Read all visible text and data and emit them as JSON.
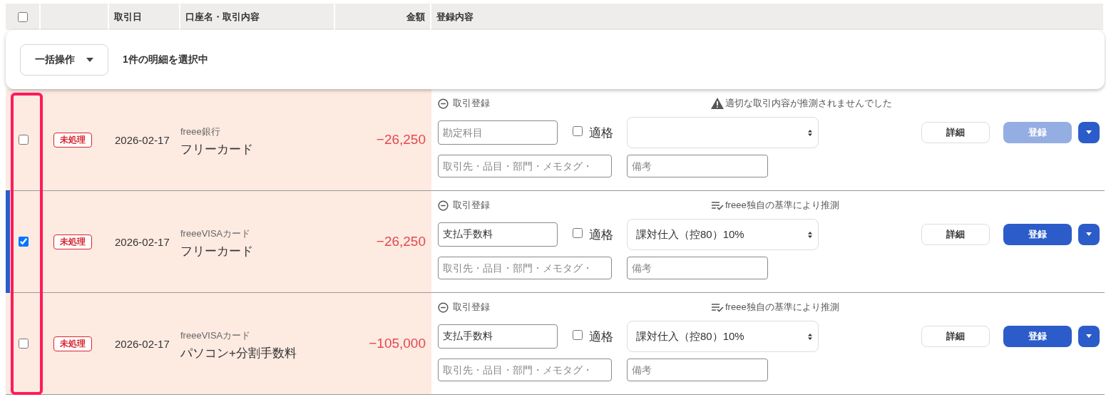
{
  "header": {
    "select_all": {
      "checked": false
    },
    "columns": [
      "取引日",
      "口座名・取引内容",
      "金額",
      "登録内容"
    ]
  },
  "bulk_bar": {
    "action": "一括操作",
    "status": "1件の明細を選択中"
  },
  "rows": [
    {
      "selected": false,
      "status": "未処理",
      "date": "2026-02-17",
      "account": "freee銀行",
      "description": "フリーカード",
      "amount": "−26,250",
      "register": {
        "toggle": "取引登録",
        "note": {
          "kind": "warning",
          "text": "適切な取引内容が推測されませんでした"
        },
        "account_field": {
          "placeholder": "勘定科目"
        },
        "qualified": {
          "label": "適格",
          "checked": false
        },
        "partner_field": {
          "placeholder": "取引先・品目・部門・メモタグ・"
        },
        "memo_field": {
          "placeholder": "備考"
        },
        "detail_button": "詳細",
        "register_button": {
          "label": "登録",
          "disabled": true
        }
      }
    },
    {
      "selected": true,
      "status": "未処理",
      "date": "2026-02-17",
      "account": "freeeVISAカード",
      "description": "フリーカード",
      "amount": "−26,250",
      "register": {
        "toggle": "取引登録",
        "note": {
          "kind": "guess",
          "text": "freee独自の基準により推測"
        },
        "account_field": {
          "value": "支払手数料"
        },
        "qualified": {
          "label": "適格",
          "checked": false
        },
        "tax_select": {
          "value": "課対仕入（控80）10%"
        },
        "partner_field": {
          "placeholder": "取引先・品目・部門・メモタグ・"
        },
        "memo_field": {
          "placeholder": "備考"
        },
        "detail_button": "詳細",
        "register_button": {
          "label": "登録",
          "disabled": false
        }
      }
    },
    {
      "selected": false,
      "status": "未処理",
      "date": "2026-02-17",
      "account": "freeeVISAカード",
      "description": "パソコン+分割手数料",
      "amount": "−105,000",
      "register": {
        "toggle": "取引登録",
        "note": {
          "kind": "guess",
          "text": "freee独自の基準により推測"
        },
        "account_field": {
          "value": "支払手数料"
        },
        "qualified": {
          "label": "適格",
          "checked": false
        },
        "tax_select": {
          "value": "課対仕入（控80）10%"
        },
        "partner_field": {
          "placeholder": "取引先・品目・部門・メモタグ・"
        },
        "memo_field": {
          "placeholder": "備考"
        },
        "detail_button": "詳細",
        "register_button": {
          "label": "登録",
          "disabled": false
        }
      }
    }
  ]
}
